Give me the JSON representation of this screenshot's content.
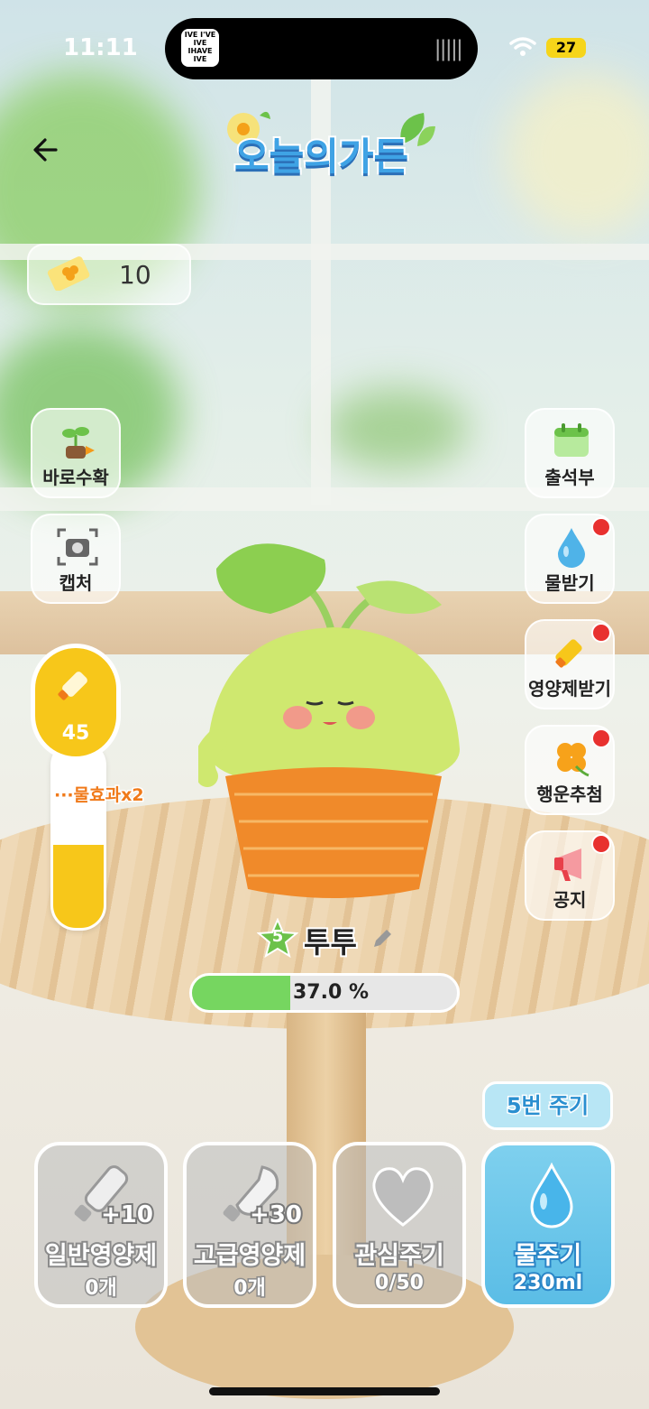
{
  "status_bar": {
    "time": "11:11",
    "battery": "27",
    "now_playing_art": "IVE I'VE IVE IHAVE IVE"
  },
  "header": {
    "logo_text": "오늘의가든",
    "back_icon": "arrow-left-icon"
  },
  "ticket": {
    "icon": "clover-ticket-icon",
    "count": "10"
  },
  "left_menu": [
    {
      "label": "바로수확",
      "icon": "sprout-harvest-icon"
    },
    {
      "label": "캡처",
      "icon": "camera-icon"
    }
  ],
  "right_menu": [
    {
      "label": "출석부",
      "icon": "calendar-icon",
      "badge": false
    },
    {
      "label": "물받기",
      "icon": "water-drop-icon",
      "badge": true
    },
    {
      "label": "영양제받기",
      "icon": "nutrient-bottle-icon",
      "badge": true
    },
    {
      "label": "행운추첨",
      "icon": "clover-icon",
      "badge": true
    },
    {
      "label": "공지",
      "icon": "megaphone-icon",
      "badge": true
    }
  ],
  "nutrient_gauge": {
    "value": "45",
    "marker_label": "물효과x2",
    "level": 0.45
  },
  "plant": {
    "level": "5",
    "name": "투투",
    "growth_percent": "37.0 %",
    "growth_fraction": 0.37
  },
  "water_tag": "5번 주기",
  "actions": [
    {
      "name": "일반영양제",
      "bonus": "+10",
      "count": "0개",
      "icon": "nutrient-bottle-icon"
    },
    {
      "name": "고급영양제",
      "bonus": "+30",
      "count": "0개",
      "icon": "premium-bottle-icon"
    },
    {
      "name": "관심주기",
      "bonus": "",
      "count": "0/50",
      "icon": "heart-icon"
    },
    {
      "name": "물주기",
      "bonus": "",
      "count": "230ml",
      "icon": "water-drop-icon"
    }
  ],
  "colors": {
    "accent_yellow": "#f7c71a",
    "progress_green": "#76d660",
    "water_blue": "#5bbde6",
    "badge_red": "#e8312f"
  }
}
